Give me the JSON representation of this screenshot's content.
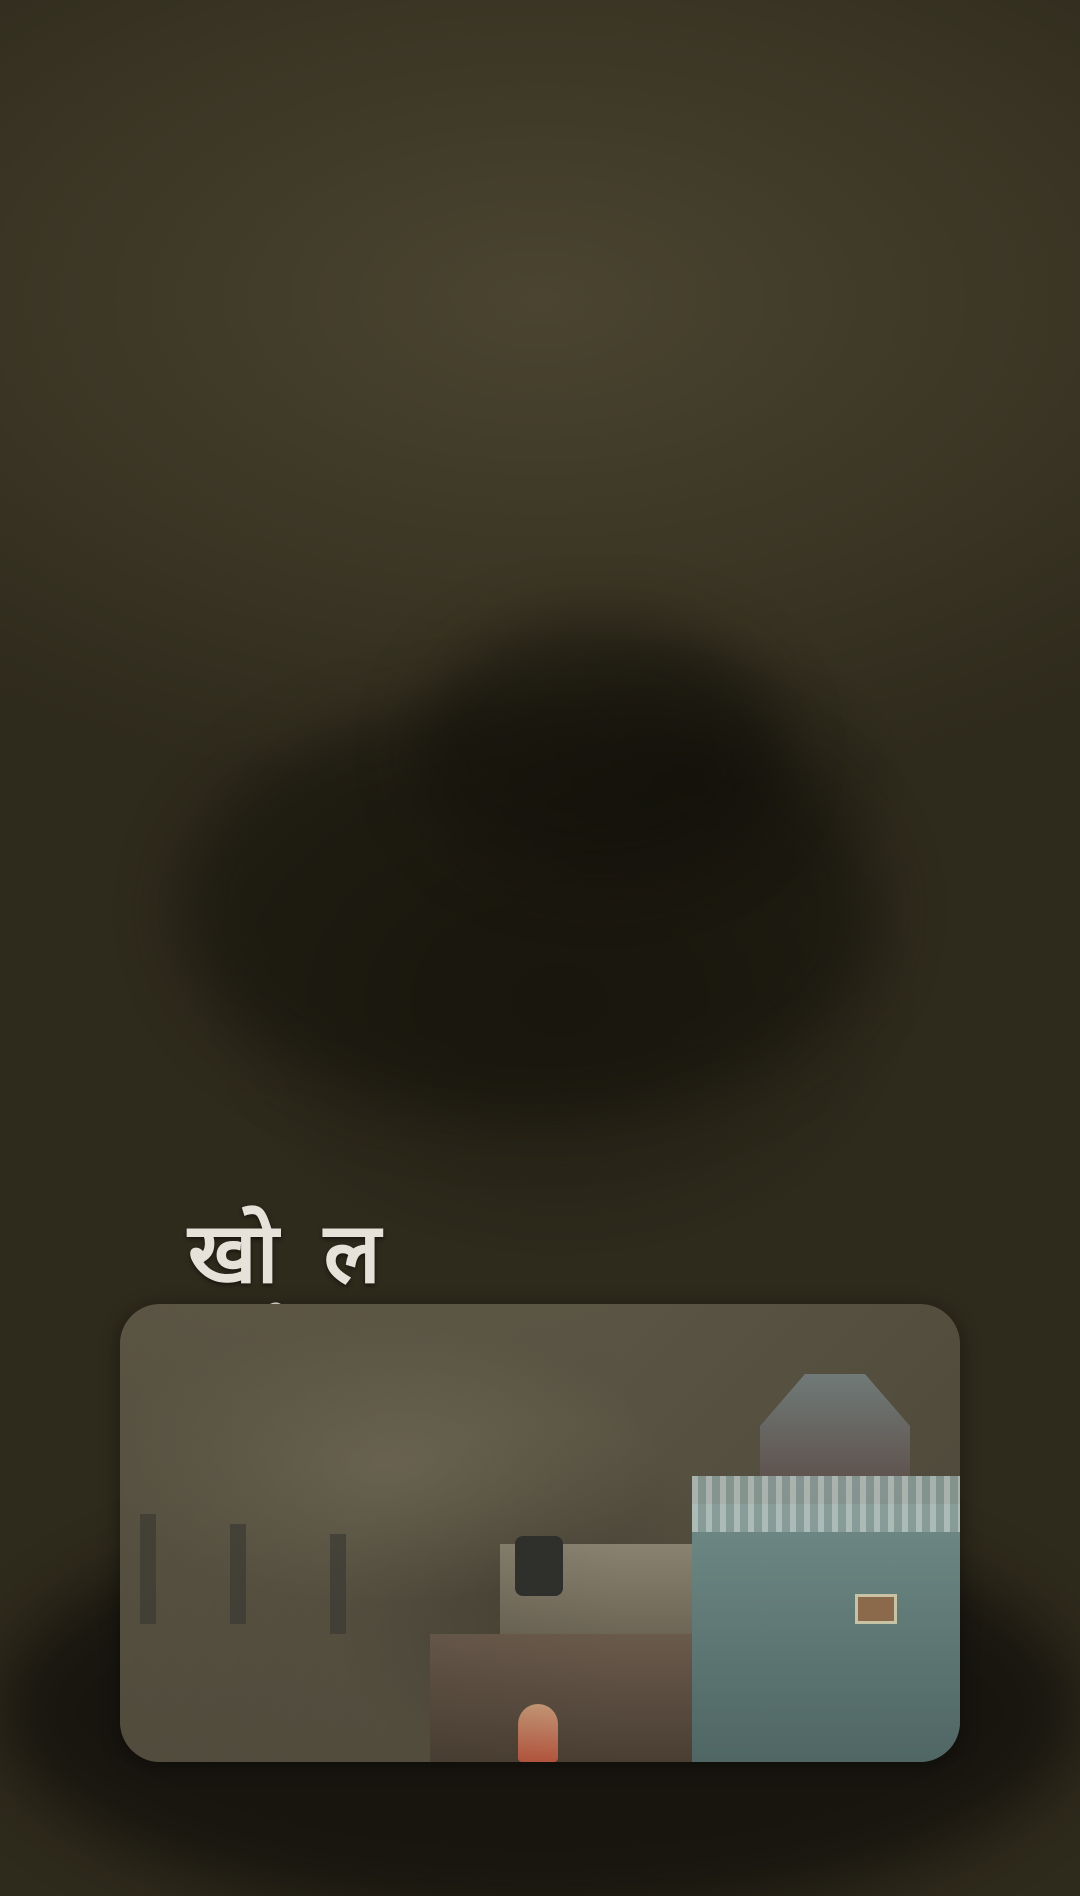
{
  "overlay_title": "खो ल"
}
